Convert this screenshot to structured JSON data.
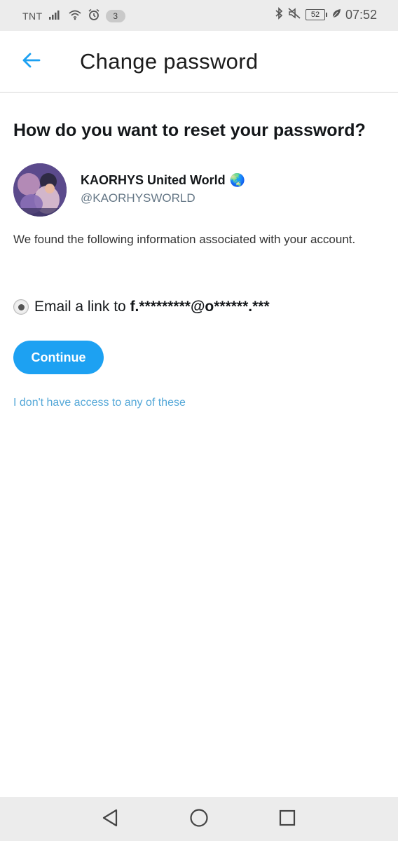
{
  "status_bar": {
    "carrier": "TNT",
    "notification_count": "3",
    "battery_level": "52",
    "time": "07:52",
    "icons": [
      "signal-icon",
      "wifi-icon",
      "alarm-icon",
      "bluetooth-icon",
      "mute-icon",
      "battery-icon",
      "leaf-icon"
    ]
  },
  "header": {
    "title": "Change password",
    "back_icon": "back-arrow-icon"
  },
  "main": {
    "heading": "How do you want to reset your password?",
    "account": {
      "name": "KAORHYS United World",
      "name_emoji": "🌏",
      "handle": "@KAORHYSWORLD"
    },
    "info_text": "We found the following information associated with your account.",
    "option": {
      "prefix": "Email a link to ",
      "email": "f.*********@o******.***",
      "selected": true
    },
    "continue_label": "Continue",
    "no_access_link": "I don't have access to any of these"
  },
  "nav_bar": {
    "icons": [
      "back-triangle-icon",
      "home-circle-icon",
      "recents-square-icon"
    ]
  },
  "colors": {
    "accent": "#1da1f2",
    "link": "#55a8d8",
    "handle": "#657786",
    "system_bar": "#ececec"
  }
}
